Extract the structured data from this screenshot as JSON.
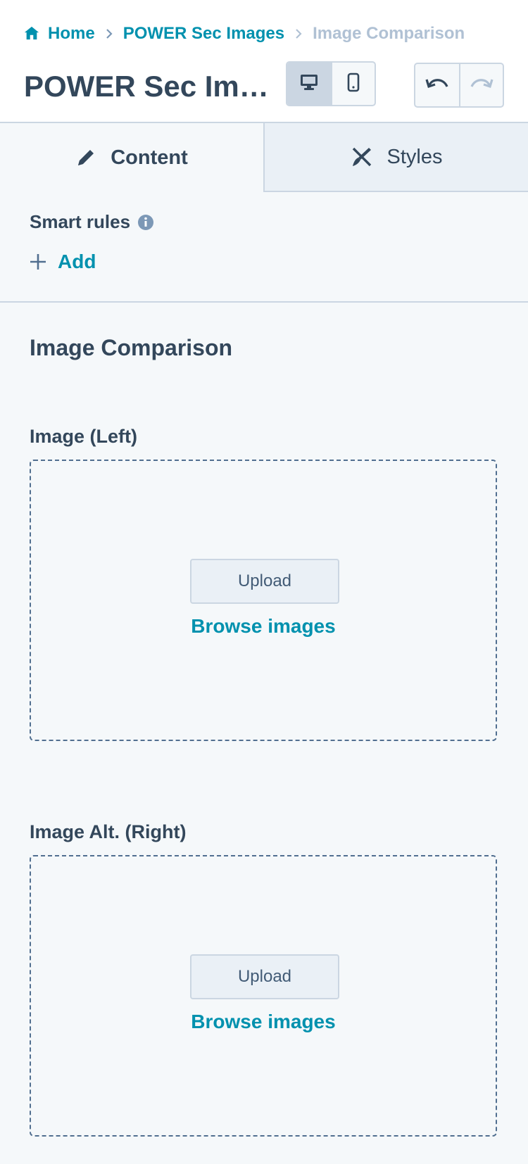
{
  "breadcrumb": {
    "home": "Home",
    "parent": "POWER Sec Images",
    "current": "Image Comparison"
  },
  "header": {
    "title": "POWER Sec Ima…",
    "view_modes": [
      "desktop-icon",
      "mobile-icon"
    ],
    "active_view": "desktop",
    "history_icons": [
      "undo-icon",
      "redo-icon"
    ]
  },
  "tabs": [
    {
      "label": "Content",
      "icon": "pencil-icon",
      "active": true
    },
    {
      "label": "Styles",
      "icon": "brush-icon",
      "active": false
    }
  ],
  "smart_rules": {
    "label": "Smart rules",
    "add_label": "Add"
  },
  "module": {
    "title": "Image Comparison",
    "fields": [
      {
        "label": "Image (Left)",
        "upload_label": "Upload",
        "browse_label": "Browse images"
      },
      {
        "label": "Image Alt. (Right)",
        "upload_label": "Upload",
        "browse_label": "Browse images"
      }
    ]
  },
  "colors": {
    "link": "#0091ae",
    "text": "#33475b",
    "border": "#cbd6e2",
    "background": "#f5f8fa"
  }
}
